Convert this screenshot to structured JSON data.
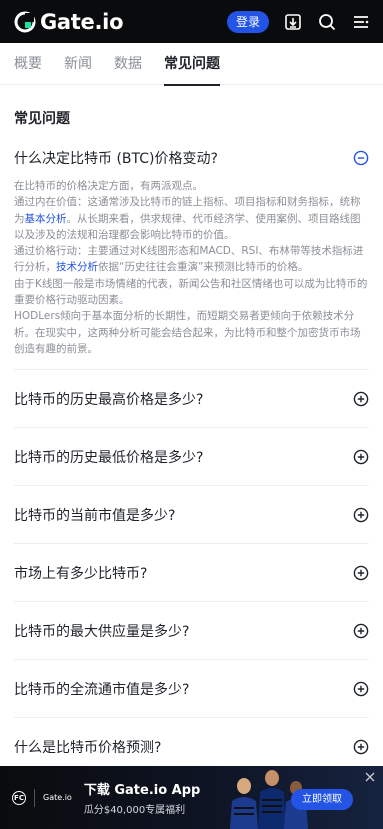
{
  "header": {
    "logo_text": "Gate.io",
    "login_label": "登录",
    "icons": [
      "download-icon",
      "search-icon",
      "menu-icon"
    ]
  },
  "tabs": [
    {
      "label": "概要",
      "active": false
    },
    {
      "label": "新闻",
      "active": false
    },
    {
      "label": "数据",
      "active": false
    },
    {
      "label": "常见问题",
      "active": true
    }
  ],
  "section_title": "常见问题",
  "faq": {
    "expanded": {
      "question": "什么决定比特币 (BTC)价格变动?",
      "answer": [
        {
          "parts": [
            {
              "text": "在比特币的价格决定方面，有两派观点。"
            }
          ]
        },
        {
          "parts": [
            {
              "text": "通过内在价值：这通常涉及比特币的链上指标、项目指标和财务指标，统称为"
            },
            {
              "text": "基本分析",
              "link": true
            },
            {
              "text": "。从长期来看，供求规律、代币经济学、使用案例、项目路线图以及涉及的法规和治理都会影响比特币的价值。"
            }
          ]
        },
        {
          "parts": [
            {
              "text": "通过价格行动：主要通过对K线图形态和MACD、RSI、布林带等技术指标进行分析，"
            },
            {
              "text": "技术分析",
              "link": true
            },
            {
              "text": "依据“历史往往会重演”来预测比特币的价格。"
            }
          ]
        },
        {
          "parts": [
            {
              "text": "由于K线图一般是市场情绪的代表，新闻公告和社区情绪也可以成为比特币的重要价格行动驱动因素。"
            }
          ]
        },
        {
          "parts": [
            {
              "text": "HODLers倾向于基本面分析的长期性，而短期交易者更倾向于依赖技术分析。在现实中，这两种分析可能会结合起来，为比特币和整个加密货币市场创造有趣的前景。"
            }
          ]
        }
      ]
    },
    "collapsed": [
      "比特币的历史最高价格是多少?",
      "比特币的历史最低价格是多少?",
      "比特币的当前市值是多少?",
      "市场上有多少比特币?",
      "比特币的最大供应量是多少?",
      "比特币的全流通市值是多少?",
      "什么是比特币价格预测?"
    ]
  },
  "banner": {
    "partner_mark": "FC",
    "logo_text": "Gate.io",
    "title": "下载 Gate.io App",
    "subtitle": "瓜分$40,000专属福利",
    "cta_label": "立即领取"
  },
  "colors": {
    "accent": "#2354e6",
    "header_bg": "#0a0b0d",
    "text_primary": "#1f2329",
    "text_secondary": "#8b8f96"
  }
}
